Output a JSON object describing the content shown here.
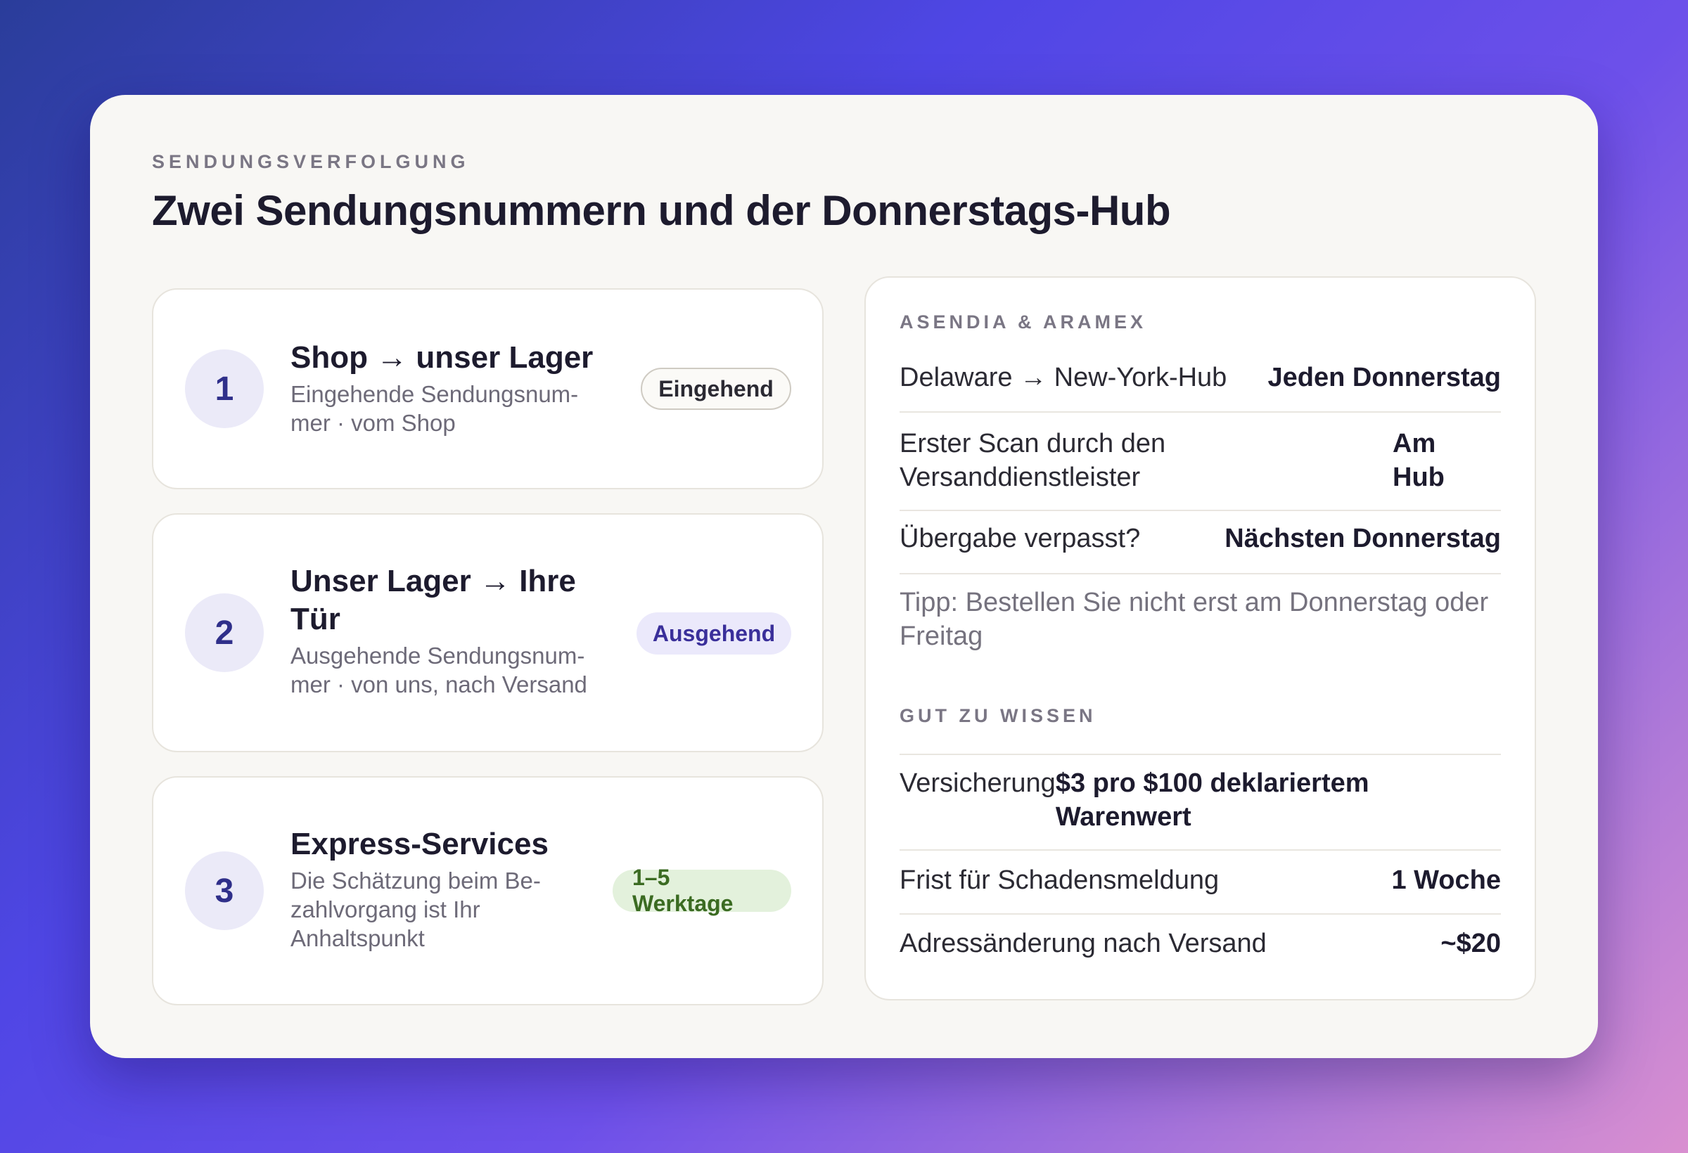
{
  "header": {
    "eyebrow": "SENDUNGSVERFOLGUNG",
    "title": "Zwei Sendungsnummern und der Donnerstags-Hub"
  },
  "steps": [
    {
      "number": "1",
      "title": "Shop → unser Lager",
      "desc": "Eingehende Sendungsnum-mer · vom Shop",
      "badge": "Eingehend"
    },
    {
      "number": "2",
      "title": "Unser Lager → Ihre Tür",
      "desc": "Ausgehende Sendungsnum-mer · von uns, nach Versand",
      "badge": "Ausgehend"
    },
    {
      "number": "3",
      "title": "Express-Services",
      "desc": "Die Schätzung beim Be-zahlvorgang ist Ihr Anhaltspunkt",
      "badge": "1–5 Werktage"
    }
  ],
  "panel": {
    "carriers_label": "ASENDIA & ARAMEX",
    "rows": [
      {
        "label": "Delaware → New-York-Hub",
        "value": "Jeden Donnerstag"
      },
      {
        "label": "Erster Scan durch den Versanddienstleister",
        "value": "Am Hub"
      },
      {
        "label": "Übergabe verpasst?",
        "value": "Nächsten Donnerstag"
      }
    ],
    "tip": "Tipp: Bestellen Sie nicht erst am Donnerstag oder Freitag",
    "info_label": "GUT ZU WISSEN",
    "info_rows": [
      {
        "label": "Versicherung",
        "value": "$3 pro $100 deklariertem Warenwert"
      },
      {
        "label": "Frist für Schadensmeldung",
        "value": "1 Woche"
      },
      {
        "label": "Adressänderung nach Versand",
        "value": "~$20"
      }
    ]
  }
}
